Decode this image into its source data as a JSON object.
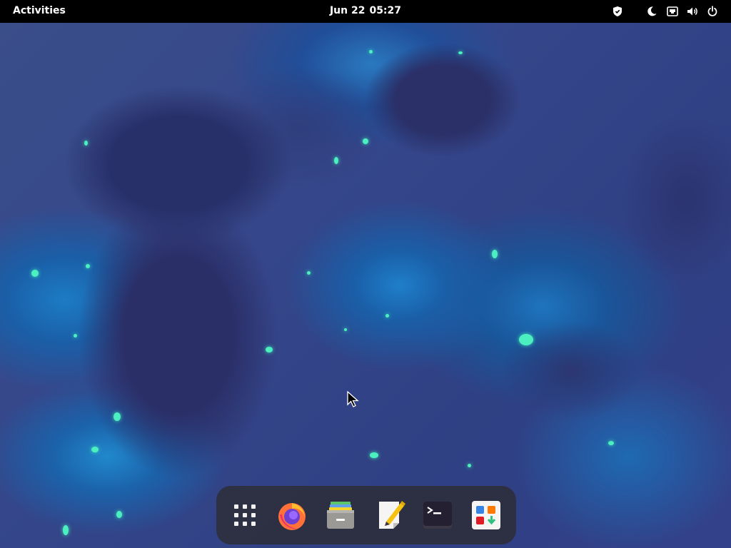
{
  "topbar": {
    "activities_label": "Activities",
    "date": "Jun 22",
    "time": "05:27",
    "tray_icons": [
      "privacy-shield-icon",
      "night-mode-icon",
      "network-wired-icon",
      "volume-icon",
      "power-icon"
    ]
  },
  "dock": {
    "items": [
      {
        "name": "show-apps",
        "icon": "app-grid-icon"
      },
      {
        "name": "firefox",
        "icon": "firefox-icon"
      },
      {
        "name": "files",
        "icon": "file-cabinet-icon"
      },
      {
        "name": "text-editor",
        "icon": "text-editor-icon"
      },
      {
        "name": "terminal",
        "icon": "terminal-icon"
      },
      {
        "name": "software",
        "icon": "software-store-icon"
      }
    ]
  },
  "colors": {
    "topbar_bg": "#000000",
    "dock_bg": "#2d2d34",
    "wallpaper_dark": "#2b2f68",
    "wallpaper_blue": "#1e7cc4",
    "speck_green": "#4cf0c0"
  }
}
